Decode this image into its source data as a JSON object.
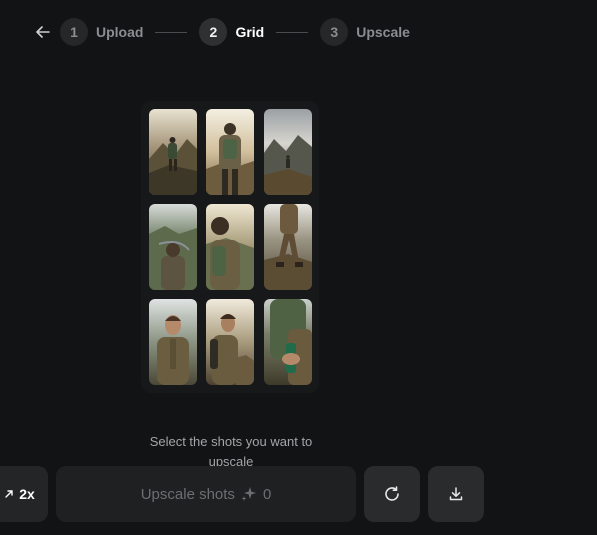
{
  "stepper": {
    "steps": [
      {
        "number": "1",
        "label": "Upload"
      },
      {
        "number": "2",
        "label": "Grid"
      },
      {
        "number": "3",
        "label": "Upscale"
      }
    ],
    "active_step": 2
  },
  "grid": {
    "shots": [
      {
        "description": "hiker-back-mountains"
      },
      {
        "description": "hiker-back-backpack"
      },
      {
        "description": "hiker-distant-valley"
      },
      {
        "description": "hiker-high-angle-valley"
      },
      {
        "description": "hiker-over-shoulder-view"
      },
      {
        "description": "hiker-walking-legs"
      },
      {
        "description": "hiker-portrait-front"
      },
      {
        "description": "hiker-profile-side"
      },
      {
        "description": "hiker-hand-bottle"
      }
    ]
  },
  "instruction": "Select the shots you want to upscale",
  "toolbar": {
    "scale_label": "2x",
    "upscale_label": "Upscale shots",
    "credits": "0"
  },
  "colors": {
    "background": "#121314",
    "button": "#242527",
    "muted_text": "#6c6e71"
  }
}
